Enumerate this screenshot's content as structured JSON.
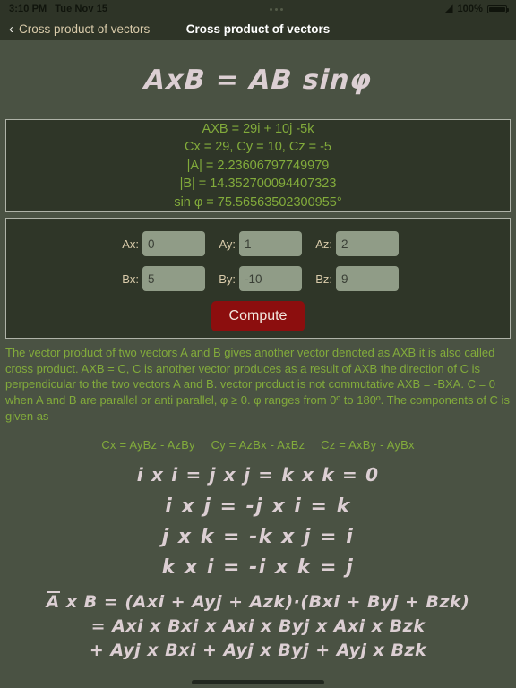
{
  "status_bar": {
    "time": "3:10 PM",
    "date": "Tue Nov 15",
    "wifi_icon": "wifi-icon",
    "battery_percent": "100%",
    "multitask_dots": "•••"
  },
  "nav_bar": {
    "back_icon": "chevron-left-icon",
    "back_label": "Cross product of vectors",
    "title": "Cross product of vectors"
  },
  "hero": {
    "formula": "AxB = AB sinφ"
  },
  "results": {
    "lines": [
      "AXB = 29i + 10j  -5k",
      "Cx = 29, Cy = 10, Cz = -5",
      "|A| = 2.23606797749979",
      "|B| = 14.352700094407323",
      "sin φ  = 75.56563502300955°"
    ]
  },
  "inputs": {
    "row1": [
      {
        "label": "Ax:",
        "value": "0"
      },
      {
        "label": "Ay:",
        "value": "1"
      },
      {
        "label": "Az:",
        "value": "2"
      }
    ],
    "row2": [
      {
        "label": "Bx:",
        "value": "5"
      },
      {
        "label": "By:",
        "value": "-10"
      },
      {
        "label": "Bz:",
        "value": "9"
      }
    ],
    "compute_label": "Compute"
  },
  "description": {
    "paragraph": "The vector product of two vectors A and B gives another vector denoted as AXB it is also called cross product. AXB = C, C is another vector produces as a result of AXB the direction of C is perpendicular to the two vectors A and B. vector product is not commutative AXB = -BXA.  C = 0 when A and B are parallel or anti parallel, φ ≥ 0.  φ  ranges from 0º to 180º.    The components of C is given as"
  },
  "component_formulas": {
    "cx": "Cx = AyBz - AzBy",
    "cy": "Cy = AzBx - AxBz",
    "cz": "Cz = AxBy - AyBx"
  },
  "unit_vector_rules": {
    "line1": "i x i = j x j = k x k = 0",
    "line2": "i x j  = -j x i  = k",
    "line3": "j x k = -k x j = i",
    "line4": "k x i = -i x k = j"
  },
  "expansion": {
    "line1_prefix": "A",
    "line1": " x B = (Axi + Ayj + Azk)·(Bxi + Byj + Bzk)",
    "line2": "= Axi x Bxi x Axi x Byj x Axi x Bzk",
    "line3": "+ Ayj x Bxi + Ayj x Byj +  Ayj x Bzk"
  },
  "colors": {
    "background": "#4A5243",
    "panel_background": "#2F3628",
    "panel_border": "#AFB3A8",
    "accent_green": "#82AB3B",
    "tan": "#D9CBAA",
    "compute_red": "#8C0E0E",
    "input_bg": "#909C87",
    "handwritten": "#DCCFD3",
    "bar_background": "#2E3427"
  }
}
